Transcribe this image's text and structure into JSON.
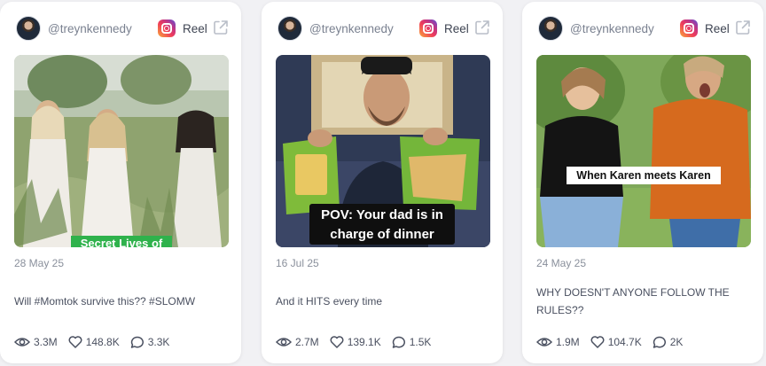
{
  "cards": [
    {
      "handle": "@treynkennedy",
      "platform_label": "Reel",
      "overlay_text": "Secret Lives of",
      "date": "28 May 25",
      "caption": "Will #Momtok survive this?? #SLOMW",
      "views": "3.3M",
      "likes": "148.8K",
      "comments": "3.3K"
    },
    {
      "handle": "@treynkennedy",
      "platform_label": "Reel",
      "overlay_line1": "POV: Your dad is in",
      "overlay_line2": "charge of dinner",
      "date": "16 Jul 25",
      "caption": "And it HITS every time",
      "views": "2.7M",
      "likes": "139.1K",
      "comments": "1.5K"
    },
    {
      "handle": "@treynkennedy",
      "platform_label": "Reel",
      "overlay_text": "When Karen meets Karen",
      "date": "24 May 25",
      "caption": "WHY DOESN'T ANYONE FOLLOW THE RULES??",
      "views": "1.9M",
      "likes": "104.7K",
      "comments": "2K"
    }
  ],
  "icons": {
    "platform": "instagram-icon",
    "external": "external-link-icon",
    "views": "eye-icon",
    "likes": "heart-icon",
    "comments": "comment-icon"
  },
  "colors": {
    "overlay_green": "#2fb24c",
    "text_muted": "#8a909c",
    "card_bg": "#ffffff"
  }
}
